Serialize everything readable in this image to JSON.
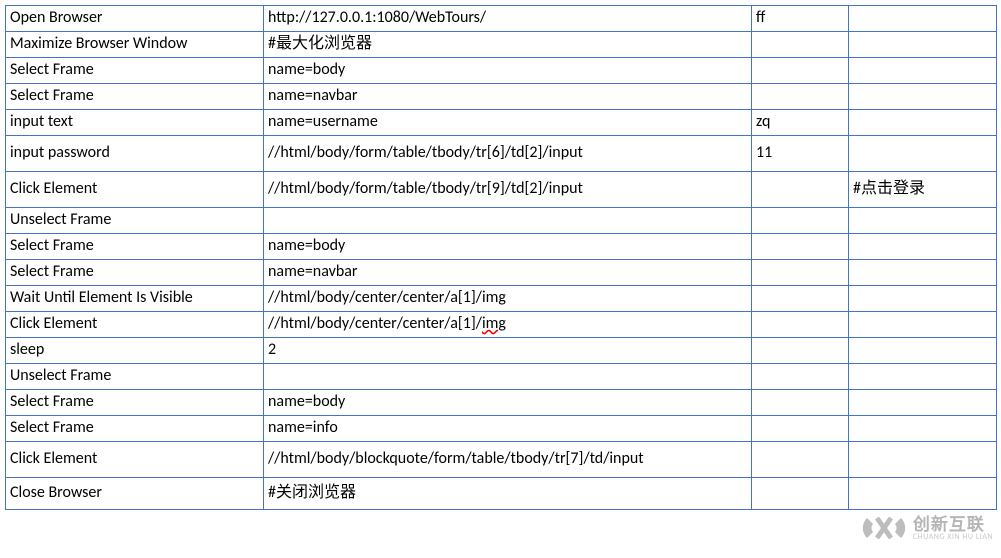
{
  "rows": [
    {
      "cls": "",
      "c1": "Open Browser",
      "c2": "http://127.0.0.1:1080/WebTours/",
      "c3": "ff",
      "c4": ""
    },
    {
      "cls": "",
      "c1": "Maximize Browser Window",
      "c2": "#最大化浏览器",
      "c3": "",
      "c4": ""
    },
    {
      "cls": "",
      "c1": "Select Frame",
      "c2": "name=body",
      "c3": "",
      "c4": ""
    },
    {
      "cls": "",
      "c1": "Select Frame",
      "c2": "name=navbar",
      "c3": "",
      "c4": ""
    },
    {
      "cls": "",
      "c1": "input text",
      "c2": "name=username",
      "c3": "zq",
      "c4": ""
    },
    {
      "cls": "tall",
      "c1": "input password",
      "c2": "//html/body/form/table/tbody/tr[6]/td[2]/input",
      "c3": "11",
      "c4": ""
    },
    {
      "cls": "tall",
      "c1": "Click Element",
      "c2": "//html/body/form/table/tbody/tr[9]/td[2]/input",
      "c3": "",
      "c4": "#点击登录"
    },
    {
      "cls": "",
      "c1": "Unselect Frame",
      "c2": "",
      "c3": "",
      "c4": ""
    },
    {
      "cls": "",
      "c1": "Select Frame",
      "c2": "name=body",
      "c3": "",
      "c4": ""
    },
    {
      "cls": "",
      "c1": "Select Frame",
      "c2": "name=navbar",
      "c3": "",
      "c4": ""
    },
    {
      "cls": "",
      "c1": "Wait Until Element Is Visible",
      "c2": "//html/body/center/center/a[1]/img",
      "c3": "",
      "c4": ""
    },
    {
      "cls": "",
      "c1": "Click Element",
      "c2_html": "//html/body/center/center/a[1]/<span class=\"underline-red\">img</span>",
      "c3": "",
      "c4": ""
    },
    {
      "cls": "",
      "c1": "sleep",
      "c2": "2",
      "c3": "",
      "c4": ""
    },
    {
      "cls": "",
      "c1": "Unselect Frame",
      "c2": "",
      "c3": "",
      "c4": ""
    },
    {
      "cls": "",
      "c1": "Select Frame",
      "c2": "name=body",
      "c3": "",
      "c4": ""
    },
    {
      "cls": "",
      "c1": "Select Frame",
      "c2": "name=info",
      "c3": "",
      "c4": ""
    },
    {
      "cls": "tall",
      "c1": "Click Element",
      "c2": "//html/body/blockquote/form/table/tbody/tr[7]/td/input",
      "c3": "",
      "c4": ""
    },
    {
      "cls": "med",
      "c1": "Close Browser",
      "c2": "#关闭浏览器",
      "c3": "",
      "c4": ""
    }
  ],
  "logo": {
    "cn": "创新互联",
    "en": "CHUANG XIN HU LIAN"
  }
}
